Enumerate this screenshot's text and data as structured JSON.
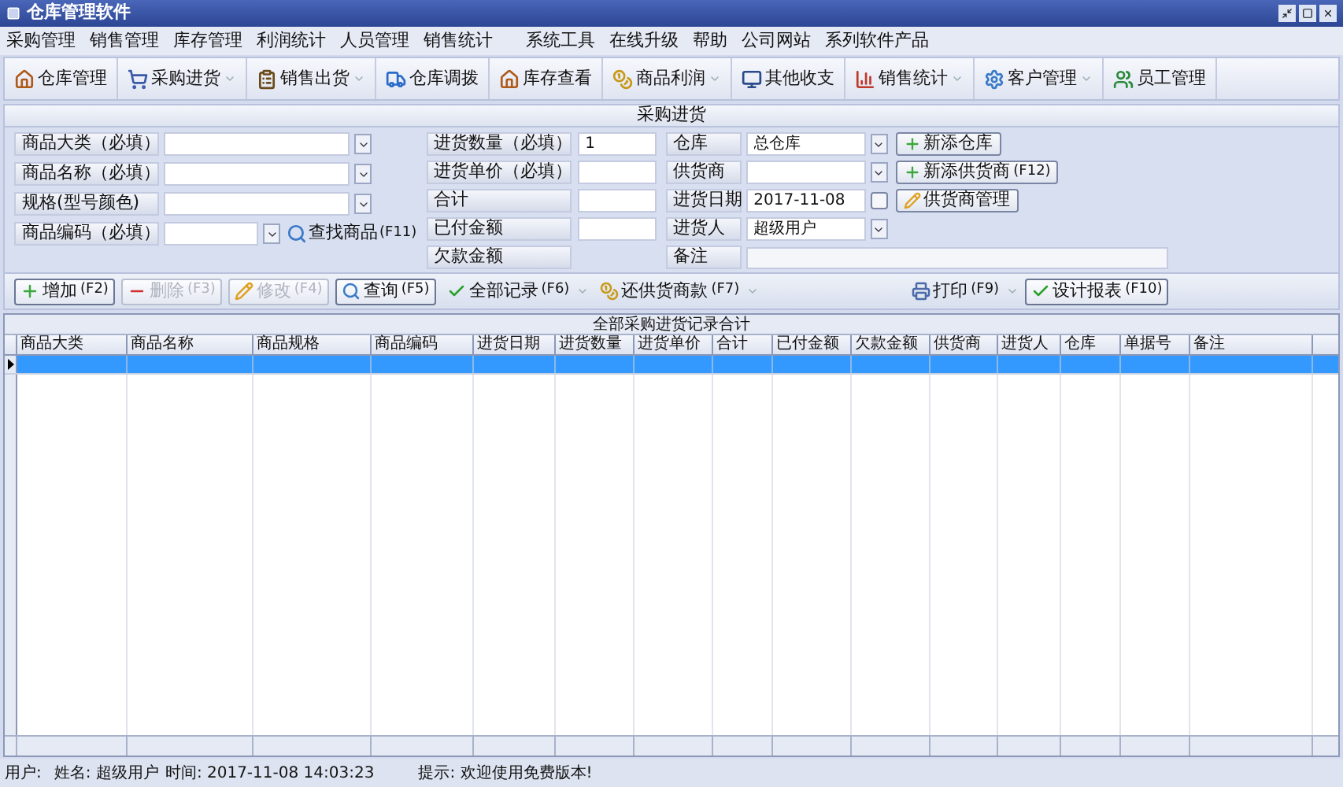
{
  "window": {
    "title": "仓库管理软件"
  },
  "menu": [
    "采购管理",
    "销售管理",
    "库存管理",
    "利润统计",
    "人员管理",
    "销售统计",
    "系统工具",
    "在线升级",
    "帮助",
    "公司网站",
    "系列软件产品"
  ],
  "toolbar": [
    {
      "label": "仓库管理",
      "dropdown": false
    },
    {
      "label": "采购进货",
      "dropdown": true
    },
    {
      "label": "销售出货",
      "dropdown": true
    },
    {
      "label": "仓库调拨",
      "dropdown": false
    },
    {
      "label": "库存查看",
      "dropdown": false
    },
    {
      "label": "商品利润",
      "dropdown": true
    },
    {
      "label": "其他收支",
      "dropdown": false
    },
    {
      "label": "销售统计",
      "dropdown": true
    },
    {
      "label": "客户管理",
      "dropdown": true
    },
    {
      "label": "员工管理",
      "dropdown": false
    }
  ],
  "section_title": "采购进货",
  "form": {
    "left": [
      {
        "label": "商品大类（必填）"
      },
      {
        "label": "商品名称（必填）"
      },
      {
        "label": "规格(型号颜色)"
      },
      {
        "label": "商品编码（必填）",
        "find_button": {
          "label": "查找商品",
          "shortcut": "(F11)"
        }
      }
    ],
    "middle": [
      {
        "label": "进货数量（必填）",
        "value": "1",
        "kind": "input"
      },
      {
        "label": "进货单价（必填）",
        "kind": "input"
      },
      {
        "label": "合计",
        "kind": "input"
      },
      {
        "label": "已付金额",
        "kind": "input"
      },
      {
        "label": "欠款金额",
        "kind": "label"
      }
    ],
    "right": [
      {
        "label": "仓库",
        "value": "总仓库",
        "kind": "dropdown"
      },
      {
        "label": "供货商",
        "kind": "dropdown"
      },
      {
        "label": "进货日期",
        "value": "2017-11-08",
        "kind": "date",
        "checked": false
      },
      {
        "label": "进货人",
        "value": "超级用户",
        "kind": "dropdown"
      },
      {
        "label": "备注",
        "kind": "wide"
      }
    ],
    "side_buttons": [
      {
        "label": "新添仓库"
      },
      {
        "label": "新添供货商",
        "shortcut": "(F12)"
      },
      {
        "label": "供货商管理"
      }
    ]
  },
  "actions": [
    {
      "label": "增加",
      "shortcut": "(F2)",
      "disabled": false,
      "dropdown": false
    },
    {
      "label": "删除",
      "shortcut": "(F3)",
      "disabled": true,
      "dropdown": false
    },
    {
      "label": "修改",
      "shortcut": "(F4)",
      "disabled": true,
      "dropdown": false
    },
    {
      "label": "查询",
      "shortcut": "(F5)",
      "disabled": false,
      "dropdown": false
    },
    {
      "label": "全部记录",
      "shortcut": "(F6)",
      "disabled": false,
      "dropdown": true
    },
    {
      "label": "还供货商款",
      "shortcut": "(F7)",
      "disabled": false,
      "dropdown": true
    },
    {
      "label": "打印",
      "shortcut": "(F9)",
      "disabled": false,
      "dropdown": true
    },
    {
      "label": "设计报表",
      "shortcut": "(F10)",
      "disabled": false,
      "dropdown": false
    }
  ],
  "table": {
    "caption": "全部采购进货记录合计",
    "columns": [
      "商品大类",
      "商品名称",
      "商品规格",
      "商品编码",
      "进货日期",
      "进货数量",
      "进货单价",
      "合计",
      "已付金额",
      "欠款金额",
      "供货商",
      "进货人",
      "仓库",
      "单据号",
      "备注"
    ],
    "rows": [
      {
        "selected": true
      }
    ]
  },
  "status_bar": {
    "user": "用户:",
    "name": "姓名: 超级用户",
    "time": "时间: 2017-11-08 14:03:23",
    "hint": "提示: 欢迎使用免费版本!"
  }
}
